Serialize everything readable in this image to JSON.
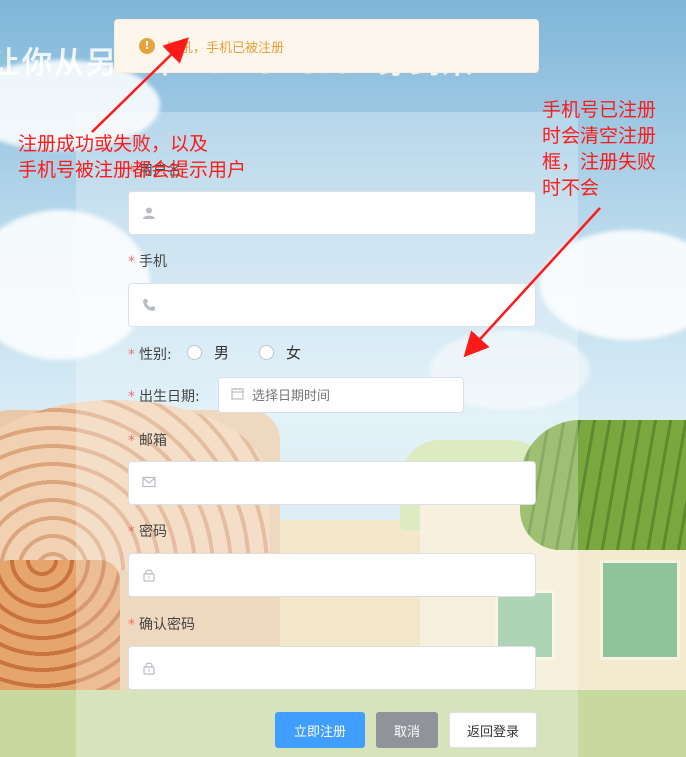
{
  "background": {
    "title": "让你从另一个Dimension穿到来"
  },
  "toast": {
    "message": "哦吼，手机已被注册",
    "color": "#e6a23c"
  },
  "form": {
    "username": {
      "label": "用户名",
      "icon": "user-icon",
      "value": ""
    },
    "phone": {
      "label": "手机",
      "icon": "phone-icon",
      "value": ""
    },
    "gender": {
      "label": "性别:",
      "options": [
        "男",
        "女"
      ]
    },
    "birthday": {
      "label": "出生日期:",
      "placeholder": "选择日期时间",
      "icon": "calendar-icon"
    },
    "email": {
      "label": "邮箱",
      "icon": "envelope-icon",
      "value": ""
    },
    "password": {
      "label": "密码",
      "icon": "lock-icon",
      "value": ""
    },
    "confirm_password": {
      "label": "确认密码",
      "icon": "lock-icon",
      "value": ""
    },
    "required_mark": "*"
  },
  "buttons": {
    "register": "立即注册",
    "cancel": "取消",
    "back_login": "返回登录"
  },
  "annotations": {
    "left_note_line1": "注册成功或失败，以及",
    "left_note_line2": "手机号被注册都会提示用户",
    "right_note_line1": "手机号已注册",
    "right_note_line2": "时会清空注册",
    "right_note_line3": "框，注册失败",
    "right_note_line4": "时不会",
    "color": "#ff1a1a"
  }
}
